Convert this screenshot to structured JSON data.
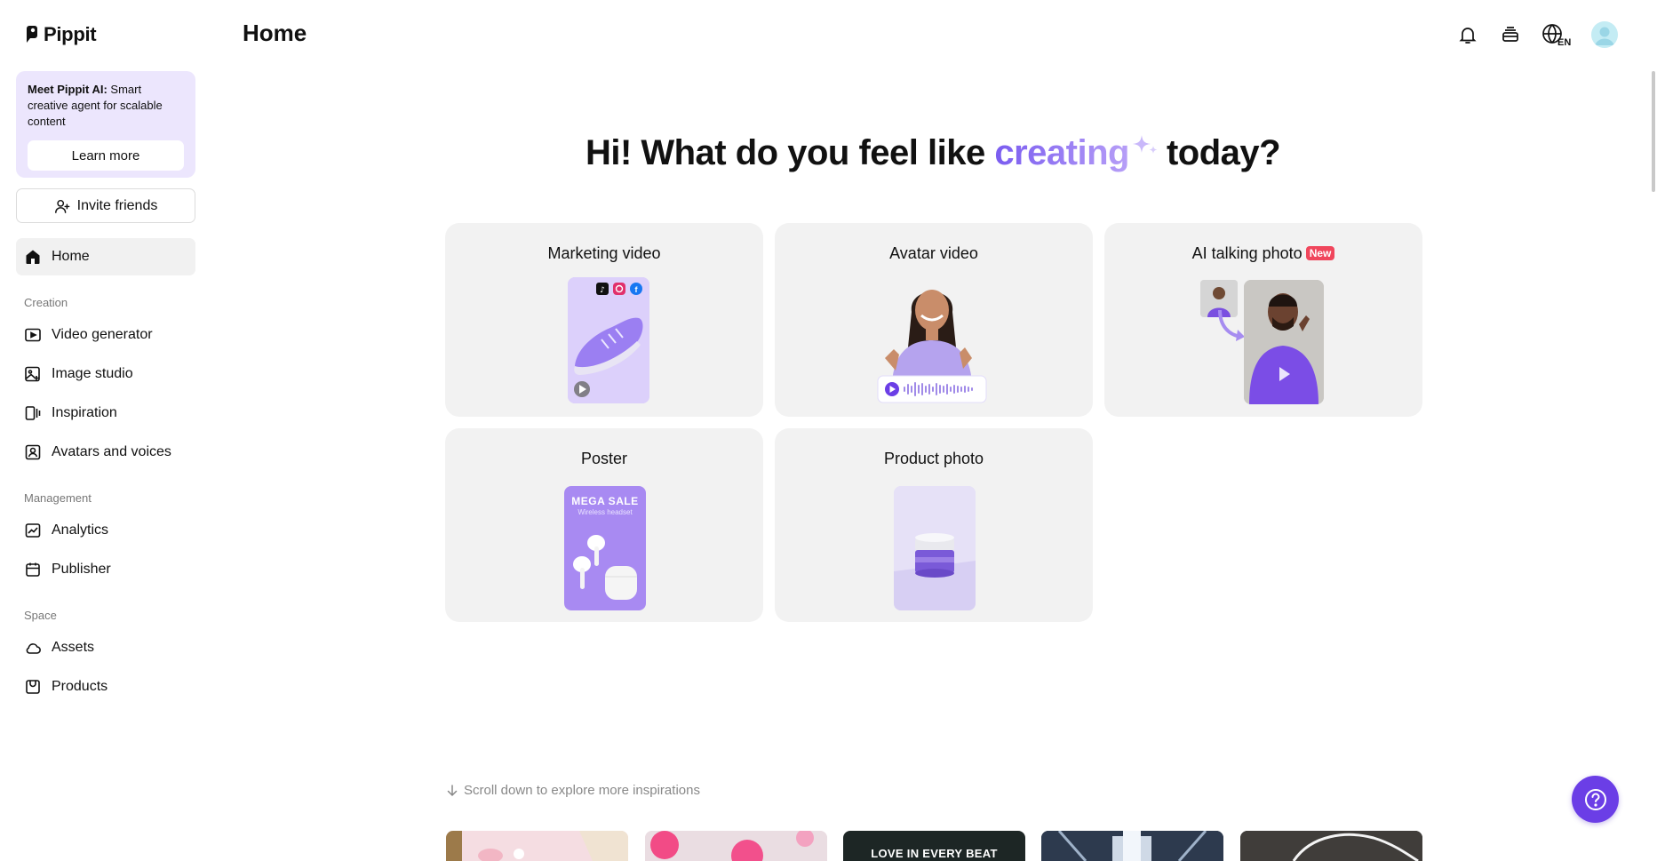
{
  "app": {
    "name": "Pippit"
  },
  "header": {
    "title": "Home",
    "language": "EN"
  },
  "promo": {
    "title": "Meet Pippit AI:",
    "body": "Smart creative agent for scalable content",
    "button": "Learn more"
  },
  "invite": {
    "label": "Invite friends"
  },
  "nav": {
    "home": "Home",
    "creation_heading": "Creation",
    "video_generator": "Video generator",
    "image_studio": "Image studio",
    "inspiration": "Inspiration",
    "avatars_voices": "Avatars and voices",
    "management_heading": "Management",
    "analytics": "Analytics",
    "publisher": "Publisher",
    "space_heading": "Space",
    "assets": "Assets",
    "products": "Products"
  },
  "hero": {
    "prefix": "Hi! What do you feel like",
    "highlight": "creating",
    "suffix": "today?"
  },
  "cards": {
    "marketing_video": "Marketing video",
    "avatar_video": "Avatar video",
    "ai_talking_photo": "AI talking photo",
    "ai_talking_photo_badge": "New",
    "poster": "Poster",
    "poster_headline": "MEGA SALE",
    "poster_subline": "Wireless headset",
    "product_photo": "Product photo"
  },
  "scroll_hint": "Scroll down to explore more inspirations",
  "inspiration_tiles": {
    "tile_3_text": "LOVE IN EVERY BEAT"
  },
  "colors": {
    "accent": "#6b3ee6",
    "promo_bg": "#ece6fd",
    "card_bg": "#f2f2f2",
    "badge": "#f0465c"
  }
}
